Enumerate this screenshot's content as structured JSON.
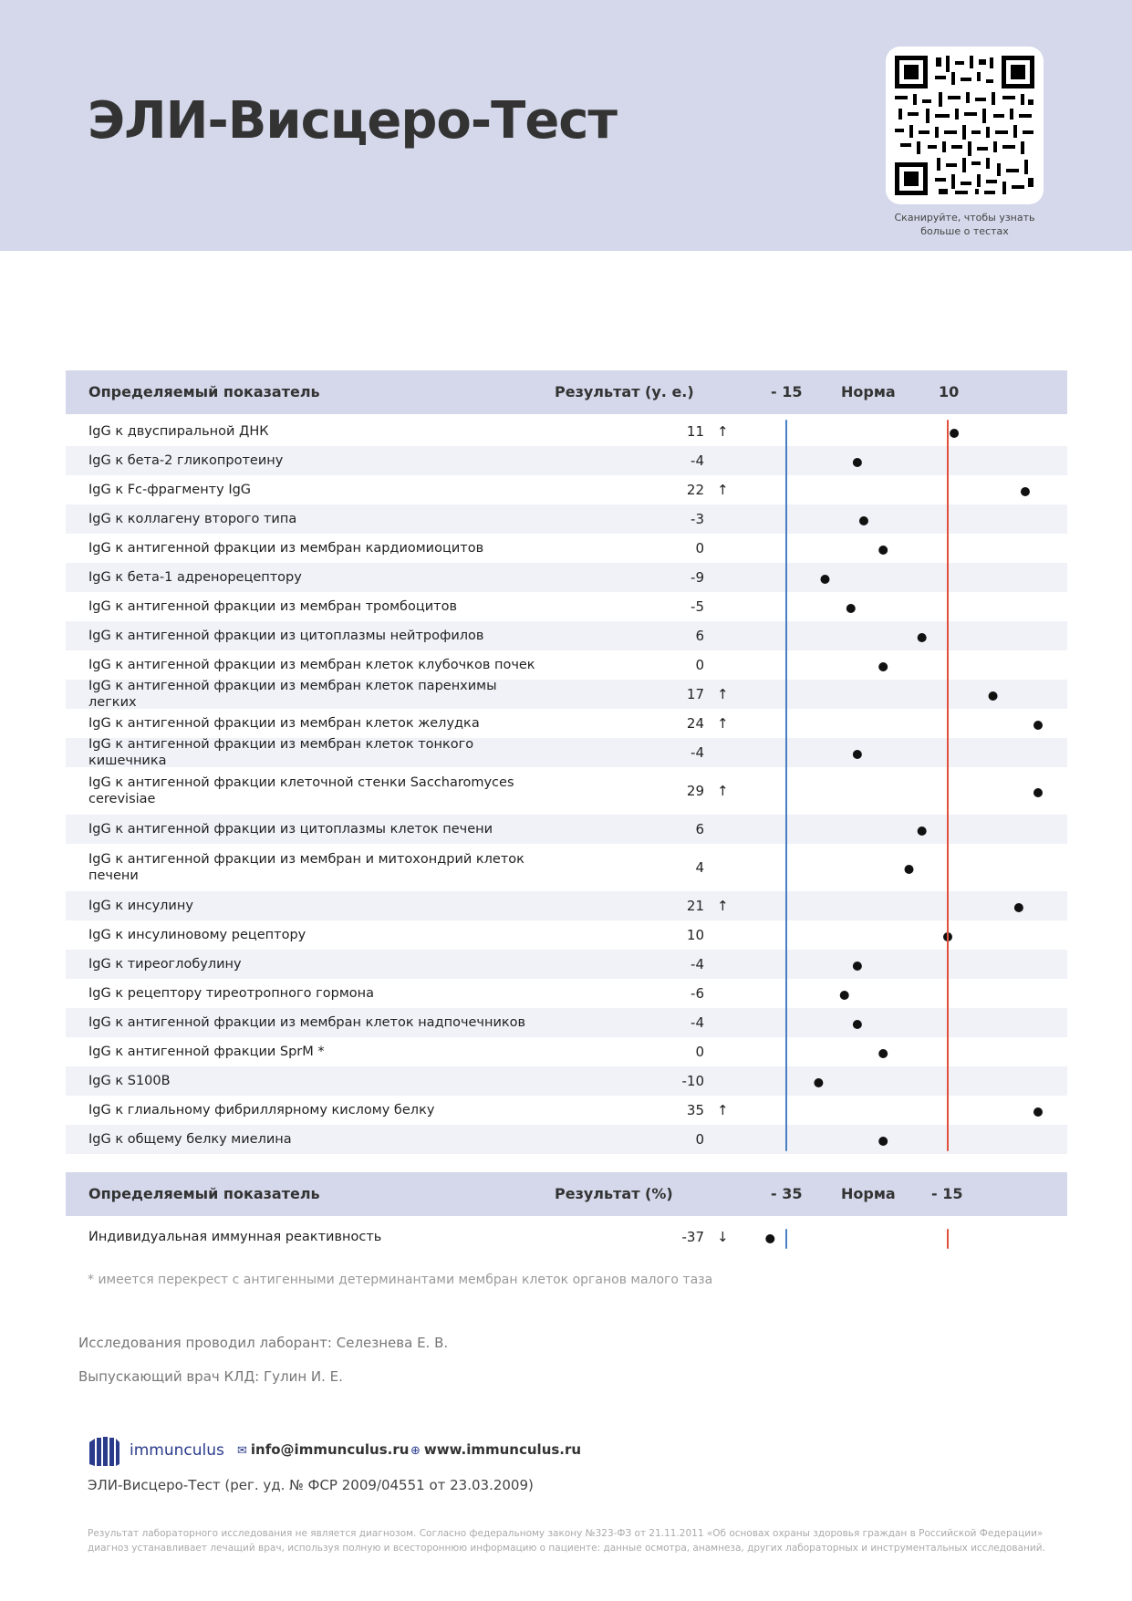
{
  "header": {
    "title": "ЭЛИ-Висцеро-Тест",
    "qr_caption": "Сканируйте, чтобы узнать больше о тестах"
  },
  "table1": {
    "col_indicator": "Определяемый показатель",
    "col_result": "Результат (у. е.)",
    "col_low": "- 15",
    "col_norm": "Норма",
    "col_high": "10",
    "low": -15,
    "high": 10,
    "rows": [
      {
        "name": "IgG к двуспиральной ДНК",
        "value": "11",
        "arrow": "↑"
      },
      {
        "name": "IgG к бета-2 гликопротеину",
        "value": "-4",
        "arrow": ""
      },
      {
        "name": "IgG к Fc-фрагменту IgG",
        "value": "22",
        "arrow": "↑"
      },
      {
        "name": "IgG к коллагену второго типа",
        "value": "-3",
        "arrow": ""
      },
      {
        "name": "IgG к антигенной фракции из мембран кардиомиоцитов",
        "value": "0",
        "arrow": ""
      },
      {
        "name": "IgG к бета-1 адренорецептору",
        "value": "-9",
        "arrow": ""
      },
      {
        "name": "IgG к антигенной фракции из мембран тромбоцитов",
        "value": "-5",
        "arrow": ""
      },
      {
        "name": "IgG к антигенной фракции из цитоплазмы нейтрофилов",
        "value": "6",
        "arrow": ""
      },
      {
        "name": "IgG к антигенной фракции из мембран клеток клубочков почек",
        "value": "0",
        "arrow": ""
      },
      {
        "name": "IgG к антигенной фракции из мембран клеток паренхимы легких",
        "value": "17",
        "arrow": "↑"
      },
      {
        "name": "IgG к антигенной фракции из мембран клеток желудка",
        "value": "24",
        "arrow": "↑"
      },
      {
        "name": "IgG к антигенной фракции из мембран клеток тонкого кишечника",
        "value": "-4",
        "arrow": ""
      },
      {
        "name": "IgG к антигенной фракции клеточной стенки Saccharomyces cerevisiae",
        "value": "29",
        "arrow": "↑"
      },
      {
        "name": "IgG к антигенной фракции из цитоплазмы клеток печени",
        "value": "6",
        "arrow": ""
      },
      {
        "name": "IgG к антигенной фракции из мембран и митохондрий клеток печени",
        "value": "4",
        "arrow": ""
      },
      {
        "name": "IgG к инсулину",
        "value": "21",
        "arrow": "↑"
      },
      {
        "name": "IgG к инсулиновому рецептору",
        "value": "10",
        "arrow": ""
      },
      {
        "name": "IgG к тиреоглобулину",
        "value": "-4",
        "arrow": ""
      },
      {
        "name": "IgG к рецептору тиреотропного гормона",
        "value": "-6",
        "arrow": ""
      },
      {
        "name": "IgG к антигенной фракции из мембран клеток надпочечников",
        "value": "-4",
        "arrow": ""
      },
      {
        "name": "IgG к антигенной фракции SprM *",
        "value": "0",
        "arrow": ""
      },
      {
        "name": "IgG к S100B",
        "value": "-10",
        "arrow": ""
      },
      {
        "name": "IgG к глиальному фибриллярному кислому белку",
        "value": "35",
        "arrow": "↑"
      },
      {
        "name": "IgG к общему белку миелина",
        "value": "0",
        "arrow": ""
      }
    ]
  },
  "table2": {
    "col_indicator": "Определяемый показатель",
    "col_result": "Результат (%)",
    "col_low": "- 35",
    "col_norm": "Норма",
    "col_high": "- 15",
    "low": -35,
    "high": -15,
    "rows": [
      {
        "name": "Индивидуальная иммунная реактивность",
        "value": "-37",
        "arrow": "↓"
      }
    ]
  },
  "footnote": "* имеется перекрест с антигенными детерминантами мембран клеток органов малого таза",
  "staff": {
    "lab": "Исследования проводил лаборант: Селезнева Е. В.",
    "doctor": "Выпускающий врач КЛД: Гулин И. Е."
  },
  "footer": {
    "brand": "immunculus",
    "email": "info@immunculus.ru",
    "site": "www.immunculus.ru",
    "reg": "ЭЛИ-Висцеро-Тест (рег. уд. № ФСР 2009/04551 от 23.03.2009)",
    "disclaimer": "Результат лабораторного исследования не является диагнозом. Согласно федеральному закону №323-ФЗ от 21.11.2011 «Об основах охраны здоровья граждан в Российской Федерации» диагноз устанавливает лечащий врач, используя полную и всестороннюю информацию о пациенте: данные осмотра, анамнеза, других лабораторных и инструментальных исследований."
  },
  "colors": {
    "header_bg": "#d4d8ea",
    "low_line": "#4a7fc1",
    "high_line": "#e0503c",
    "grad_start": "#17b3dc",
    "grad_mid": "#8ccf4a",
    "grad_end": "#e63f2c"
  }
}
